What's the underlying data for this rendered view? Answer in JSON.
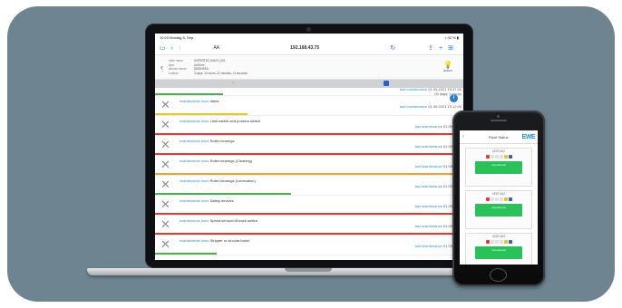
{
  "laptop": {
    "status_left": "10:20  Montag 5. Sep.",
    "status_right": "• 92 % ▮",
    "url": "192.168.43.75",
    "aa_label": "AA",
    "device": {
      "keys": [
        "drive name",
        "type",
        "service server",
        "runtime"
      ],
      "values": [
        "SUPERTEC MACH_001",
        "AnDrive",
        "ID5DHEE5",
        "3 days, 10 hours, 22 minutes, 11 seconds"
      ]
    },
    "action_label": "action",
    "rows": [
      {
        "prefix": "maintenance work",
        "title": "Idlers",
        "right_label": "last maintenance",
        "right_date": "01.09.2021 15:12:00",
        "bar_color": "#f0c419",
        "bar_width": 0.3
      },
      {
        "prefix": "maintenance work",
        "title": "Limit switch and position switch",
        "right_label": "last maintenance",
        "right_date": "01.09.2021",
        "bar_color": "#e53935",
        "bar_width": 1.0
      },
      {
        "prefix": "maintenance work",
        "title": "Roller bearings",
        "right_label": "last maintenance",
        "right_date": "01.09.2021",
        "bar_color": "#e53935",
        "bar_width": 1.0
      },
      {
        "prefix": "maintenance work",
        "title": "Roller bearings (Cleaning)",
        "right_label": "last maintenance",
        "right_date": "01.09.2021",
        "bar_color": "#e8a33a",
        "bar_width": 1.0
      },
      {
        "prefix": "maintenance work",
        "title": "Roller bearings (Lubrication)",
        "right_label": "last maintenance",
        "right_date": "01.09.2021",
        "bar_color": "#4caf50",
        "bar_width": 0.44
      },
      {
        "prefix": "maintenance work",
        "title": "Safety devices",
        "right_label": "last maintenance",
        "right_date": "01.09.2021",
        "bar_color": "#e53935",
        "bar_width": 1.0
      },
      {
        "prefix": "maintenance work",
        "title": "Speed sensor/off-track switch",
        "right_label": "last maintenance",
        "right_date": "01.09.2021",
        "bar_color": "#e53935",
        "bar_width": 1.0
      },
      {
        "prefix": "maintenance work",
        "title": "Stripper or circular brush",
        "right_label": "last maintenance",
        "right_date": "01.09.2021",
        "bar_color": "#4caf50",
        "bar_width": 0.2
      }
    ],
    "top_right_date": "01.09.2021 15:37:00",
    "top_right_sub": "00 days, 0 hours"
  },
  "phone": {
    "title": "Plant Status",
    "logo": "EWE",
    "units": [
      {
        "name": "UNIT A01",
        "button": "Operational"
      },
      {
        "name": "UNIT A02",
        "button": "Operational"
      },
      {
        "name": "UNIT A03",
        "button": "Operational"
      }
    ]
  }
}
